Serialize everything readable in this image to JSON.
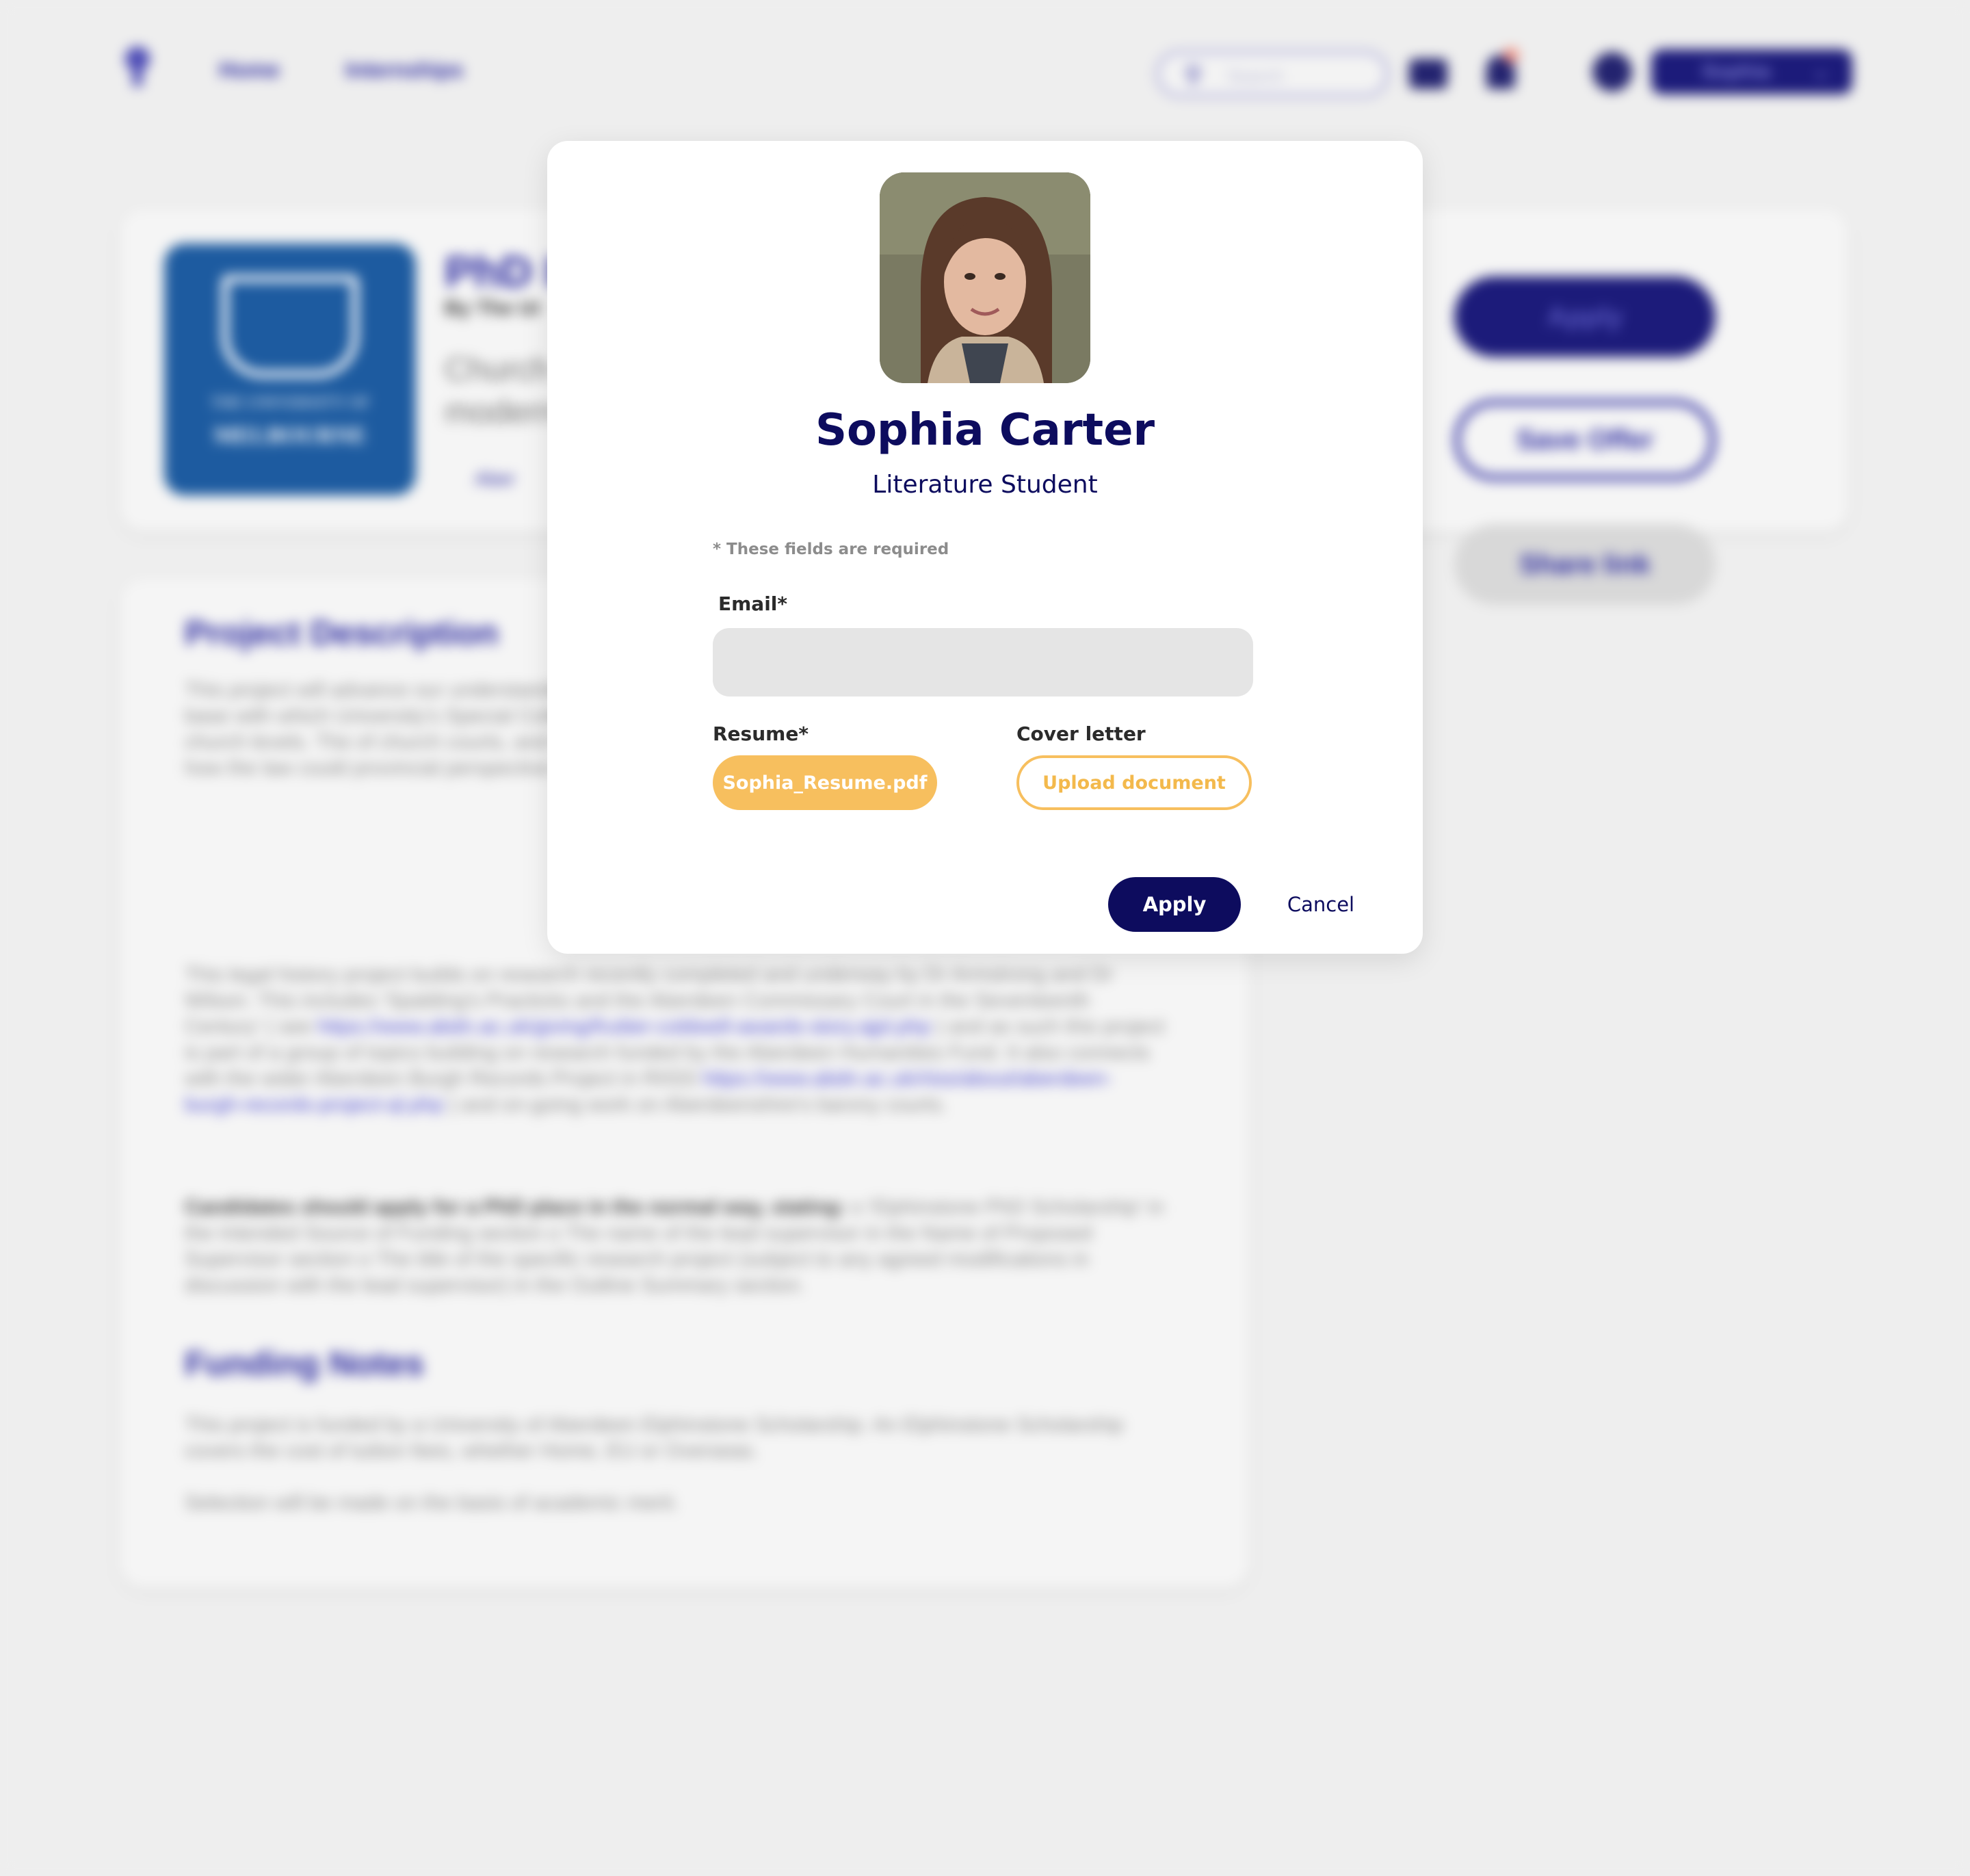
{
  "background": {
    "nav": {
      "links": [
        "Home",
        "Internships"
      ],
      "search_placeholder": "Search",
      "user_name": "Sophia"
    },
    "offer": {
      "logo_line1": "THE UNIVERSITY OF",
      "logo_line2": "MELBOURNE",
      "title": "PhD I",
      "by": "By The Ur",
      "subtitle": "Church modern",
      "tag": "Aber",
      "apply_label": "Apply",
      "save_label": "Save Offer",
      "share_label": "Share link"
    },
    "description": {
      "heading": "Project Description",
      "p1": "This project will advance our understanding of Scotland from the late fifteenth to the present a rich source base with which University's Special Collections Centre for the investigation of the range of sheriffdom, and church levels. The of church courts, and the dynamics emergence and development of a an examination of how the law could provincial perspective rather than that",
      "p2": "This legal history project builds on research recently completed and underway by Dr Armstrong and Dr Wilson. This includes 'Spalding's Practicks and the Aberdeen Commissary Court in the Seventeenth Century' ( see",
      "link1": "https://www.abdn.ac.uk/giving/fruitier-coldwell-awards-story.ajpl.php",
      "p2b": ") and as such this project is part of a group of topics building on research funded by the Aberdeen Humanities Fund. It also connects with the wider Aberdeen Burgh Records Project in RIISS",
      "link2": "https://www.abdn.ac.uk/riiss/about/aberdeen-burgh-records-project-ql.php",
      "p2c": ") and on-going work on Aberdeenshire's barony courts.",
      "p3_bold": "Candidates should apply for a PhD place in the normal way, stating:",
      "p3": "o 'Elphinstone PhD Scholarship' in the Intended Source of Funding section o The name of the lead supervisor in the Name of Proposed Supervisor section o The title of the specific research project (subject to any agreed modifications in discussion with the lead supervisor) in the Outline Summary section.",
      "funding_heading": "Funding Notes",
      "f1": "This project is funded by a University of Aberdeen Elphinstone Scholarship. An Elphinstone Scholarship covers the cost of tuition fees, whether Home, EU or Overseas.",
      "f2": "Selection will be made on the basis of academic merit."
    }
  },
  "modal": {
    "name": "Sophia Carter",
    "role": "Literature Student",
    "required_note": "* These fields are required",
    "email_label": "Email*",
    "email_value": "",
    "resume_label": "Resume*",
    "resume_file": "Sophia_Resume.pdf",
    "cover_label": "Cover letter",
    "upload_label": "Upload document",
    "apply_label": "Apply",
    "cancel_label": "Cancel"
  },
  "colors": {
    "brand_navy": "#0d0c5e",
    "accent_orange": "#f7bf5e",
    "bg_gray": "#eeeeee"
  }
}
